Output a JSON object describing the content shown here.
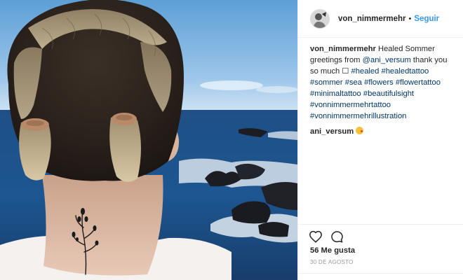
{
  "post": {
    "owner": "von_nimmermehr",
    "separator": "•",
    "follow_label": "Seguir",
    "caption": {
      "username": "von_nimmermehr",
      "text_1": "Healed Sommer greetings from",
      "mention": "@ani_versum",
      "text_2": "thank you so much ☐",
      "hashtags": [
        "#healed",
        "#healedtattoo",
        "#sommer",
        "#sea",
        "#flowers",
        "#flowertattoo",
        "#minimaltattoo",
        "#beautifulsight",
        "#vonnimmermehrtattoo",
        "#vonnimmermehrillustration"
      ]
    },
    "comment": {
      "username": "ani_versum",
      "emoji": "kissing-face-with-heart"
    },
    "actions": {
      "like_icon": "heart-icon",
      "comment_icon": "comment-icon"
    },
    "likes": "56 Me gusta",
    "date": "30 DE AGOSTO"
  },
  "colors": {
    "link": "#003569",
    "follow": "#3897f0",
    "text": "#262626",
    "muted": "#999999"
  }
}
